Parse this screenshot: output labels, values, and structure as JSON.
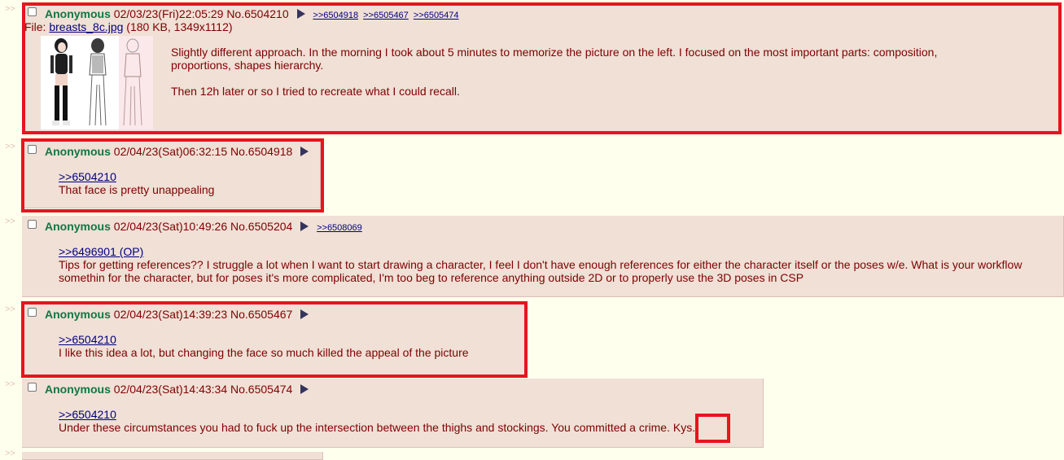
{
  "arrows": ">>",
  "posts": [
    {
      "name": "Anonymous",
      "datetime": "02/03/23(Fri)22:05:29",
      "postno": "No.6504210",
      "backlinks": [
        ">>6504918",
        ">>6505467",
        ">>6505474"
      ],
      "file": {
        "prefix": "File: ",
        "name": "breasts_8c.jpg",
        "meta": " (180 KB, 1349x1112)"
      },
      "message": [
        "Slightly different approach. In the morning I took about 5 minutes to memorize the picture on the left. I focused on the most important parts: composition,",
        "proportions, shapes hierarchy.",
        "Then 12h later or so I tried to recreate what I could recall."
      ]
    },
    {
      "name": "Anonymous",
      "datetime": "02/04/23(Sat)06:32:15",
      "postno": "No.6504918",
      "quote": ">>6504210",
      "message": [
        "That face is pretty unappealing"
      ]
    },
    {
      "name": "Anonymous",
      "datetime": "02/04/23(Sat)10:49:26",
      "postno": "No.6505204",
      "backlinks": [
        ">>6508069"
      ],
      "quote": ">>6496901 (OP)",
      "message": [
        "Tips for getting references?? I struggle a lot when I want to start drawing a character, I feel I don't have enough references for either the character itself or the poses w/e. What is your workflow",
        "somethin for the character, but for poses it's more complicated, I'm too beg to reference anything outside 2D or to properly use the 3D poses in CSP"
      ]
    },
    {
      "name": "Anonymous",
      "datetime": "02/04/23(Sat)14:39:23",
      "postno": "No.6505467",
      "quote": ">>6504210",
      "message": [
        "I like this idea a lot, but changing the face so much killed the appeal of the picture"
      ]
    },
    {
      "name": "Anonymous",
      "datetime": "02/04/23(Sat)14:43:34",
      "postno": "No.6505474",
      "quote": ">>6504210",
      "message": [
        "Under these circumstances you had to fuck up the intersection between the thighs and stockings. You committed a crime. ",
        "Kys."
      ]
    }
  ],
  "colors": {
    "page_bg": "#ffffee",
    "reply_bg": "#f0e0d6",
    "text": "#800000",
    "name": "#117743",
    "link": "#000080",
    "highlight": "#e8141e"
  }
}
